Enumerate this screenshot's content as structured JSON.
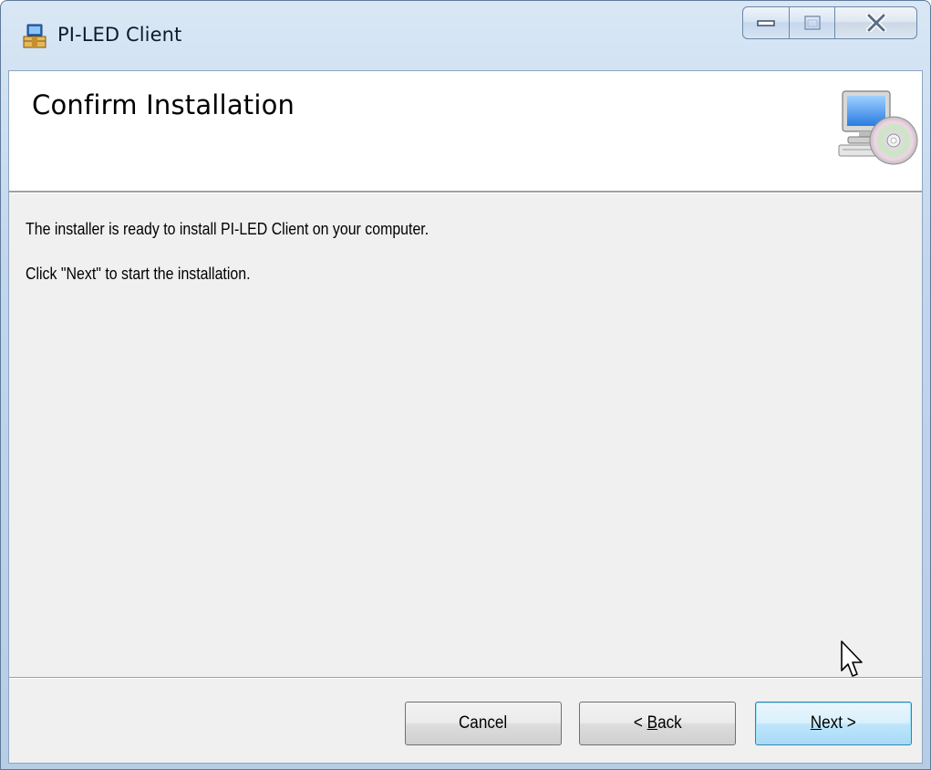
{
  "window": {
    "title": "PI-LED Client",
    "caption_buttons": [
      "minimize",
      "maximize",
      "close"
    ]
  },
  "banner": {
    "title": "Confirm Installation",
    "icon": "computer-cd-icon"
  },
  "body": {
    "line1": "The installer is ready to install PI-LED Client on your computer.",
    "line2": "Click \"Next\" to start the installation."
  },
  "buttons": {
    "cancel": "Cancel",
    "back_prefix": "< ",
    "back_accel": "B",
    "back_rest": "ack",
    "next_accel": "N",
    "next_rest": "ext >"
  },
  "colors": {
    "frame": "#b7cde6",
    "client": "#f0f0f0",
    "default_button": "#bee6fd"
  }
}
